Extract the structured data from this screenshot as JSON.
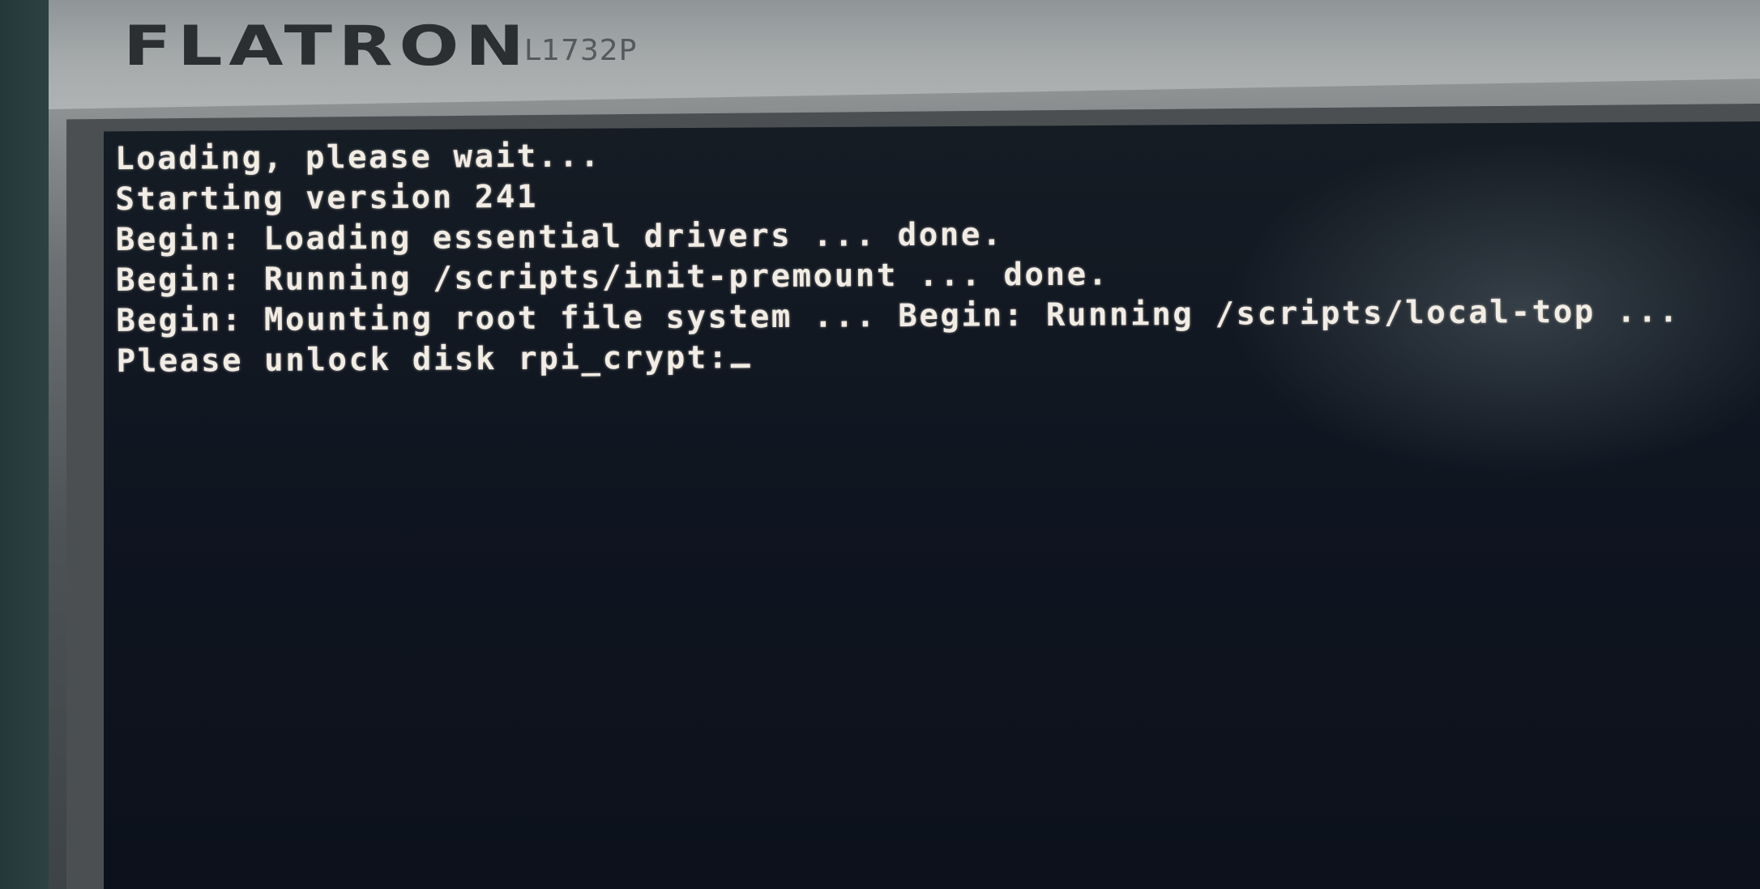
{
  "monitor": {
    "brand": "FLATRON",
    "model": "L1732P"
  },
  "console": {
    "lines": [
      "Loading, please wait...",
      "Starting version 241",
      "Begin: Loading essential drivers ... done.",
      "Begin: Running /scripts/init-premount ... done.",
      "Begin: Mounting root file system ... Begin: Running /scripts/local-top ...",
      "Please unlock disk rpi_crypt:"
    ]
  },
  "colors": {
    "text": "#f1ece4",
    "screen": "#0f1520",
    "bezel": "#8e9293"
  }
}
